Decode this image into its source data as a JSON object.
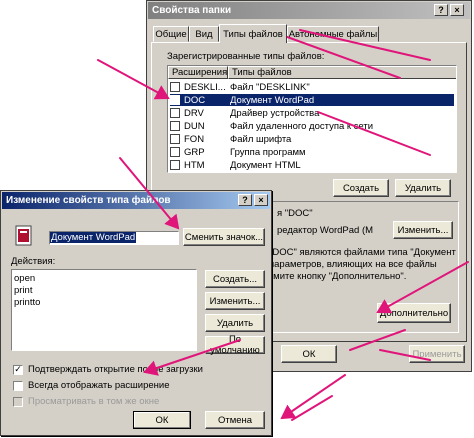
{
  "back_window": {
    "title": "Свойства папки",
    "tabs": [
      "Общие",
      "Вид",
      "Типы файлов",
      "Автономные файлы"
    ],
    "registered_label": "Зарегистрированные типы файлов:",
    "columns": [
      "Расширения",
      "Типы файлов"
    ],
    "rows": [
      {
        "ext": "DESKLI...",
        "type": "Файл \"DESKLINK\""
      },
      {
        "ext": "DOC",
        "type": "Документ WordPad"
      },
      {
        "ext": "DRV",
        "type": "Драйвер устройства"
      },
      {
        "ext": "DUN",
        "type": "Файл удаленного доступа к сети"
      },
      {
        "ext": "FON",
        "type": "Файл шрифта"
      },
      {
        "ext": "GRP",
        "type": "Группа программ"
      },
      {
        "ext": "HTM",
        "type": "Документ HTML"
      }
    ],
    "create_button": "Создать",
    "delete_button": "Удалить",
    "details_line1": "я \"DOC\"",
    "details_line2": "редактор WordPad (M",
    "change_button": "Изменить...",
    "details_text1": "\"DOC\" являются файлами типа \"Документ",
    "details_text2": "параметров, влияющих на все файлы",
    "details_text3": "кмите кнопку \"Дополнительно\".",
    "advanced_button": "Дополнительно",
    "ok_button": "ОК",
    "apply_button": "Применить"
  },
  "front_window": {
    "title": "Изменение свойств типа файлов",
    "type_name": "Документ WordPad",
    "change_icon_button": "Сменить значок...",
    "actions_label": "Действия:",
    "actions": [
      "open",
      "print",
      "printto"
    ],
    "create_button": "Создать...",
    "edit_button": "Изменить...",
    "remove_button": "Удалить",
    "default_button": "По умолчанию",
    "confirm_open": "Подтверждать открытие после загрузки",
    "always_show_ext": "Всегда отображать расширение",
    "browse_same_window": "Просматривать в том же окне",
    "ok_button": "ОК",
    "cancel_button": "Отмена"
  },
  "colors": {
    "title_active": "#0a246a",
    "title_gradient_end": "#a6caf0",
    "title_inactive": "#808080",
    "arrow": "#e0157a",
    "selection": "#0a246a"
  }
}
